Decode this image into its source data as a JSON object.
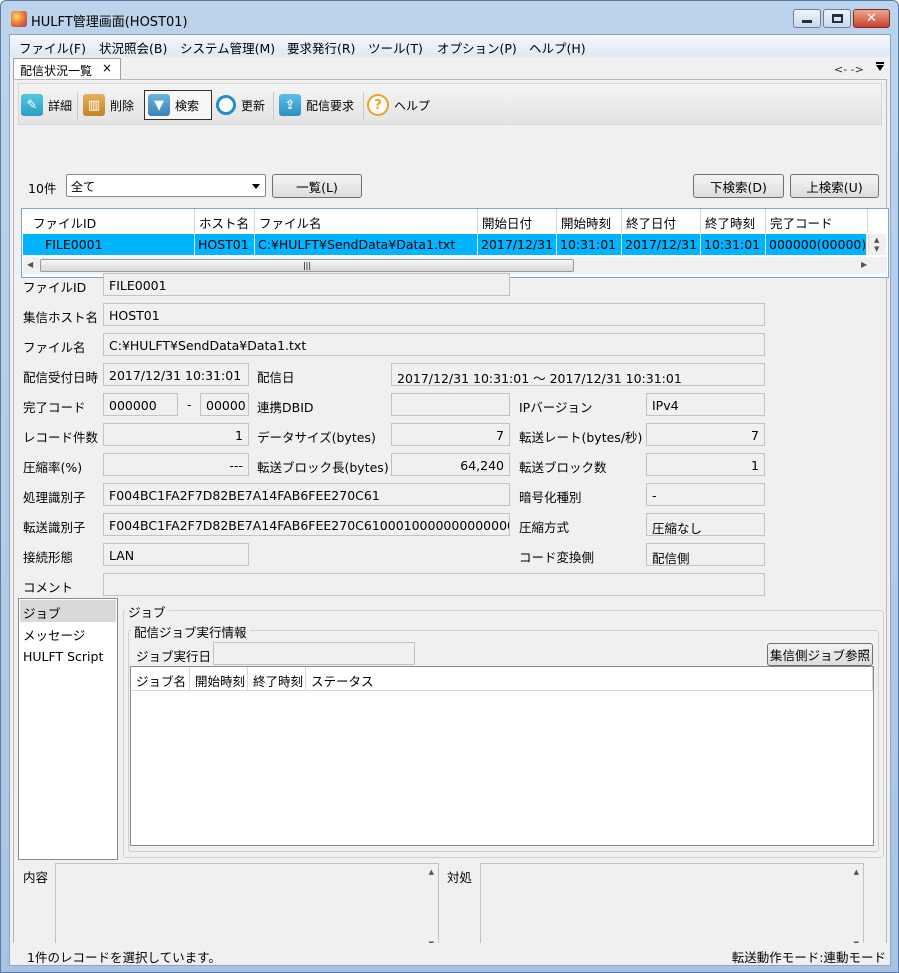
{
  "window": {
    "title": "HULFT管理画面(HOST01)",
    "app_icon": "hulft-logo-icon"
  },
  "menu": [
    "ファイル(F)",
    "状況照会(B)",
    "システム管理(M)",
    "要求発行(R)",
    "ツール(T)",
    "オプション(P)",
    "ヘルプ(H)"
  ],
  "tab": {
    "label": "配信状況一覧",
    "close": "×",
    "nav": "<- ->"
  },
  "toolbar": {
    "detail": "詳細",
    "delete": "削除",
    "search": "検索",
    "refresh": "更新",
    "request": "配信要求",
    "help": "ヘルプ"
  },
  "filter": {
    "count": "10件",
    "combo_value": "全て",
    "list_button": "一覧(L)",
    "down_search": "下検索(D)",
    "up_search": "上検索(U)"
  },
  "grid": {
    "columns": [
      "ファイルID",
      "ホスト名",
      "ファイル名",
      "開始日付",
      "開始時刻",
      "終了日付",
      "終了時刻",
      "完了コード"
    ],
    "rows": [
      [
        "FILE0001",
        "HOST01",
        "C:¥HULFT¥SendData¥Data1.txt",
        "2017/12/31",
        "10:31:01",
        "2017/12/31",
        "10:31:01",
        "000000(00000)"
      ]
    ],
    "selected_color": "#00b4ff"
  },
  "detail": {
    "file_id": {
      "label": "ファイルID",
      "value": "FILE0001"
    },
    "host": {
      "label": "集信ホスト名",
      "value": "HOST01"
    },
    "file_name": {
      "label": "ファイル名",
      "value": "C:¥HULFT¥SendData¥Data1.txt"
    },
    "received": {
      "label": "配信受付日時",
      "value": "2017/12/31 10:31:01"
    },
    "delivery_date": {
      "label": "配信日",
      "value": "2017/12/31 10:31:01 ～ 2017/12/31 10:31:01"
    },
    "complete_code": {
      "label": "完了コード",
      "value1": "000000",
      "dash": "-",
      "value2": "00000"
    },
    "link_dbid": {
      "label": "連携DBID",
      "value": ""
    },
    "ip_version": {
      "label": "IPバージョン",
      "value": "IPv4"
    },
    "record_count": {
      "label": "レコード件数",
      "value": "1"
    },
    "data_size": {
      "label": "データサイズ(bytes)",
      "value": "7"
    },
    "transfer_rate": {
      "label": "転送レート(bytes/秒)",
      "value": "7"
    },
    "compression_rate": {
      "label": "圧縮率(%)",
      "value": "---"
    },
    "block_length": {
      "label": "転送ブロック長(bytes)",
      "value": "64,240"
    },
    "block_count": {
      "label": "転送ブロック数",
      "value": "1"
    },
    "process_id": {
      "label": "処理識別子",
      "value": "F004BC1FA2F7D82BE7A14FAB6FEE270C61"
    },
    "encryption": {
      "label": "暗号化種別",
      "value": "-"
    },
    "transfer_id": {
      "label": "転送識別子",
      "value": "F004BC1FA2F7D82BE7A14FAB6FEE270C610001000000000000000000"
    },
    "compression_method": {
      "label": "圧縮方式",
      "value": "圧縮なし"
    },
    "connection": {
      "label": "接続形態",
      "value": "LAN"
    },
    "code_conversion": {
      "label": "コード変換側",
      "value": "配信側"
    },
    "comment": {
      "label": "コメント",
      "value": ""
    }
  },
  "side_list": [
    "ジョブ",
    "メッセージ",
    "HULFT Script"
  ],
  "job": {
    "group_title": "ジョブ",
    "sub_title": "配信ジョブ実行情報",
    "exec_date_label": "ジョブ実行日",
    "exec_date_value": "",
    "ref_button": "集信側ジョブ参照",
    "columns": [
      "ジョブ名",
      "開始時刻",
      "終了時刻",
      "ステータス"
    ]
  },
  "bottom": {
    "content_label": "内容",
    "action_label": "対処"
  },
  "status": {
    "left": "1件のレコードを選択しています。",
    "right": "転送動作モード:連動モード"
  }
}
